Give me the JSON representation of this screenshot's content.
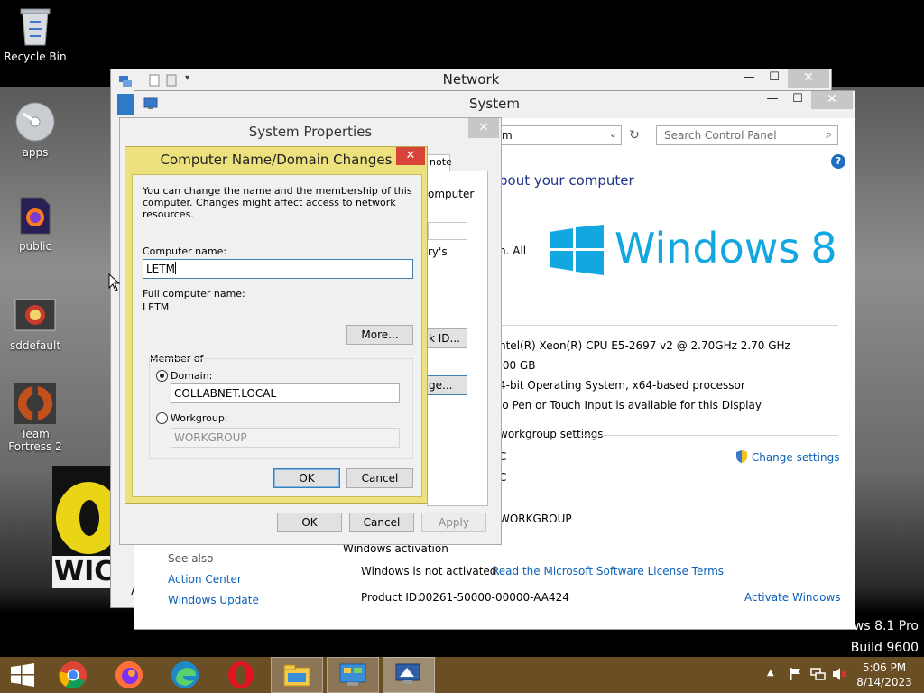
{
  "desktop": {
    "icons": [
      {
        "label": "Recycle Bin",
        "icon": "recycle-bin-icon"
      },
      {
        "label": "apps",
        "icon": "disc-icon"
      },
      {
        "label": "public",
        "icon": "firefox-file-icon"
      },
      {
        "label": "sddefault",
        "icon": "image-icon"
      },
      {
        "label": "Team Fortress 2",
        "icon": "team-fortress-icon"
      }
    ],
    "watermark": {
      "line1": "ows 8.1 Pro",
      "line2": "Build 9600"
    },
    "partial_image_text": "WIC"
  },
  "network_window": {
    "title": "Network"
  },
  "system_window": {
    "title": "System",
    "address_text": "m",
    "search_placeholder": "Search Control Panel",
    "heading": "bout your computer",
    "logo_text": "Windows",
    "logo_num": "8",
    "copyright_partial": "n. All",
    "specs": [
      "ntel(R) Xeon(R) CPU E5-2697 v2 @ 2.70GHz   2.70 GHz",
      ".00 GB",
      "4-bit Operating System, x64-based processor",
      "lo Pen or Touch Input is available for this Display"
    ],
    "workgroup_section": "workgroup settings",
    "change_settings": "Change settings",
    "name_row1": "C",
    "name_row2": "C",
    "workgroup_value": "WORKGROUP",
    "see_also": "See also",
    "action_center": "Action Center",
    "windows_update": "Windows Update",
    "activation_section": "Windows activation",
    "not_activated": "Windows is not activated.",
    "license_link": "Read the Microsoft Software License Terms",
    "product_id_label": "Product ID:",
    "product_id": "00261-50000-00000-AA424",
    "activate_link": "Activate Windows",
    "left_partial": "7"
  },
  "sysprops": {
    "title": "System Properties",
    "remote_tab": "note",
    "bg_text1": "omputer",
    "bg_text2": "ry's",
    "network_id_btn": "k ID...",
    "change_btn": "ge...",
    "ok": "OK",
    "cancel": "Cancel",
    "apply": "Apply"
  },
  "dialog": {
    "title": "Computer Name/Domain Changes",
    "description": "You can change the name and the membership of this computer. Changes might affect access to network resources.",
    "computer_name_label": "Computer name:",
    "computer_name_value": "LETM",
    "full_name_label": "Full computer name:",
    "full_name_value": "LETM",
    "more_btn": "More...",
    "member_of": "Member of",
    "domain_label": "Domain:",
    "domain_value": "COLLABNET.LOCAL",
    "workgroup_label": "Workgroup:",
    "workgroup_value": "WORKGROUP",
    "ok": "OK",
    "cancel": "Cancel"
  },
  "taskbar": {
    "time": "5:06 PM",
    "date": "8/14/2023",
    "apps": [
      "chrome-icon",
      "firefox-icon",
      "edge-icon",
      "opera-icon",
      "file-explorer-icon",
      "control-panel-icon",
      "system-properties-icon"
    ]
  },
  "colors": {
    "accent": "#0b61b8",
    "dialog_frame": "#ece17c",
    "taskbar": "#6b4f24",
    "close_red": "#d9443a"
  }
}
